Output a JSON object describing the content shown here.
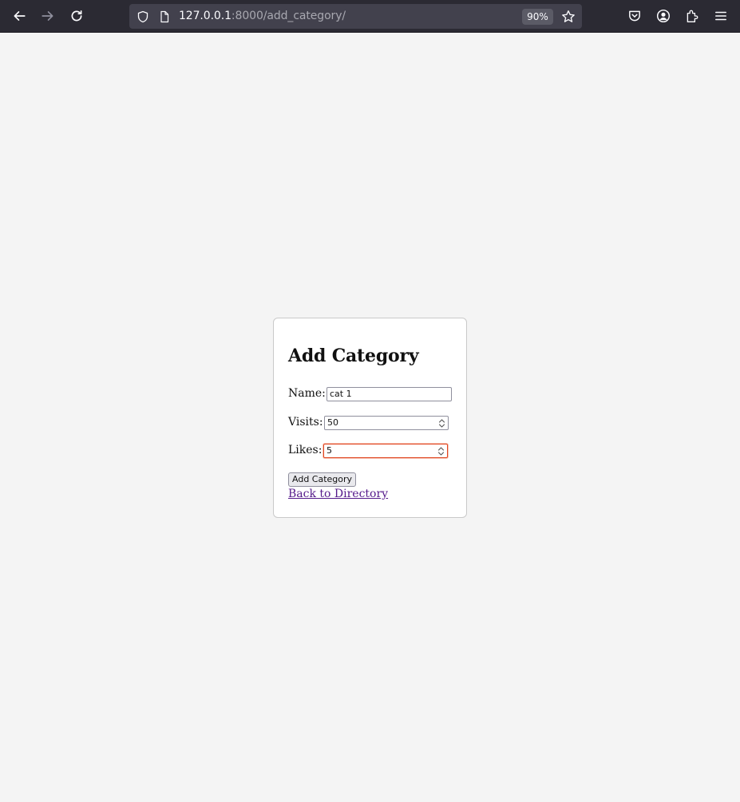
{
  "browser": {
    "url_host": "127.0.0.1",
    "url_path": ":8000/add_category/",
    "zoom": "90%"
  },
  "form": {
    "title": "Add Category",
    "name_label": "Name:",
    "name_value": "cat 1",
    "visits_label": "Visits:",
    "visits_value": "50",
    "likes_label": "Likes:",
    "likes_value": "5",
    "submit_label": "Add Category",
    "back_link": "Back to Directory"
  },
  "colors": {
    "toolbar": "#2b2a33",
    "urlbar": "#42414d",
    "page_bg": "#f4f4f4",
    "link": "#551a8b",
    "focus_ring": "#e0451f"
  }
}
